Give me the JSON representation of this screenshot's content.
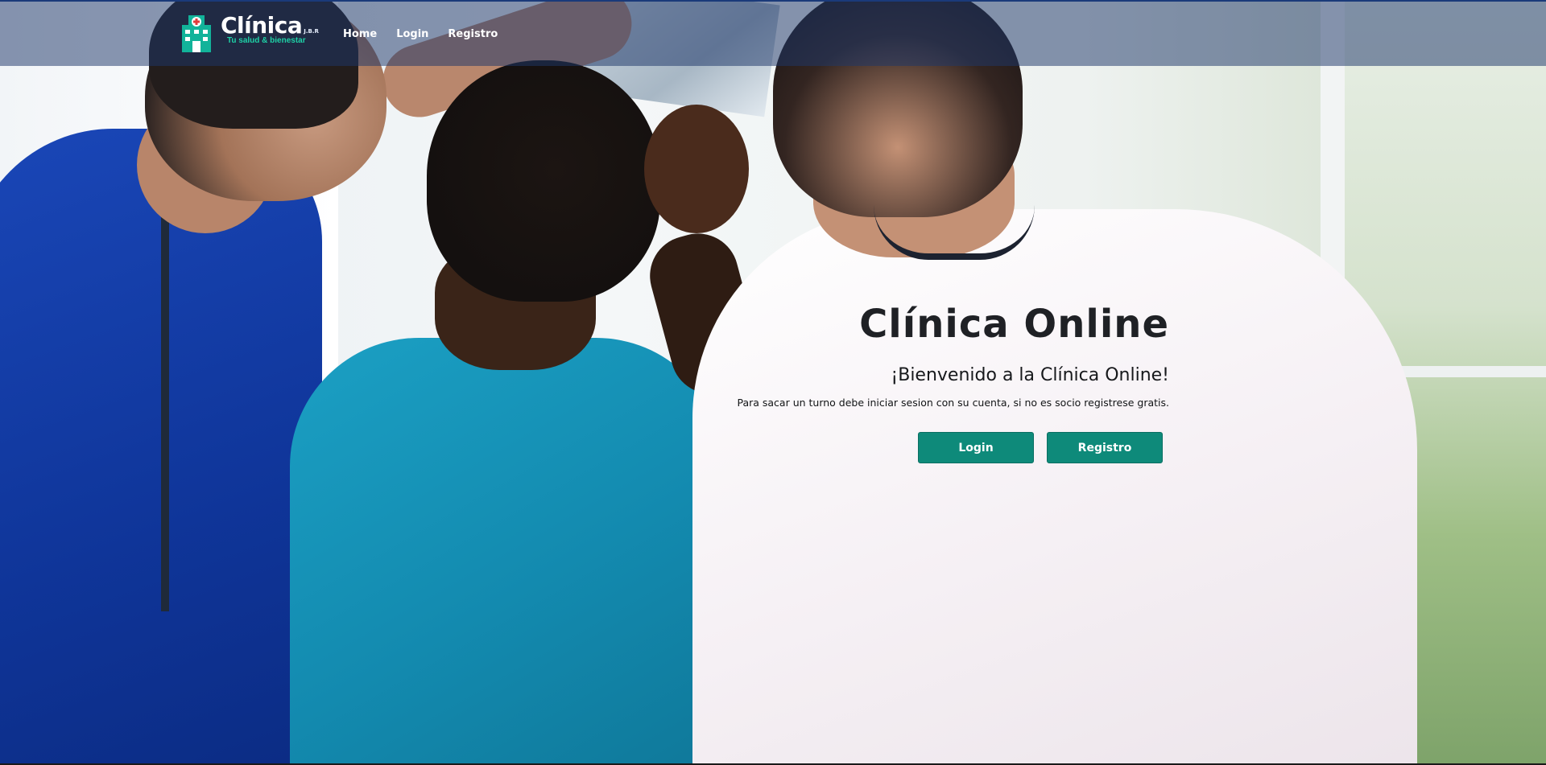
{
  "navbar": {
    "brand_name": "Clínica",
    "brand_suffix": "J.B.R",
    "brand_tagline": "Tu salud & bienestar",
    "links": [
      {
        "label": "Home"
      },
      {
        "label": "Login"
      },
      {
        "label": "Registro"
      }
    ]
  },
  "hero": {
    "title": "Clínica Online",
    "subtitle": "¡Bienvenido a la Clínica Online!",
    "text": "Para sacar un turno debe iniciar sesion con su cuenta, si no es socio registrese gratis.",
    "login_button": "Login",
    "register_button": "Registro"
  },
  "colors": {
    "navbar_bg": "#1e3769",
    "button_bg": "#0e8a7a",
    "brand_accent": "#1ed1a6",
    "title_text": "#1f2125"
  },
  "icons": {
    "brand": "hospital-building-icon"
  }
}
